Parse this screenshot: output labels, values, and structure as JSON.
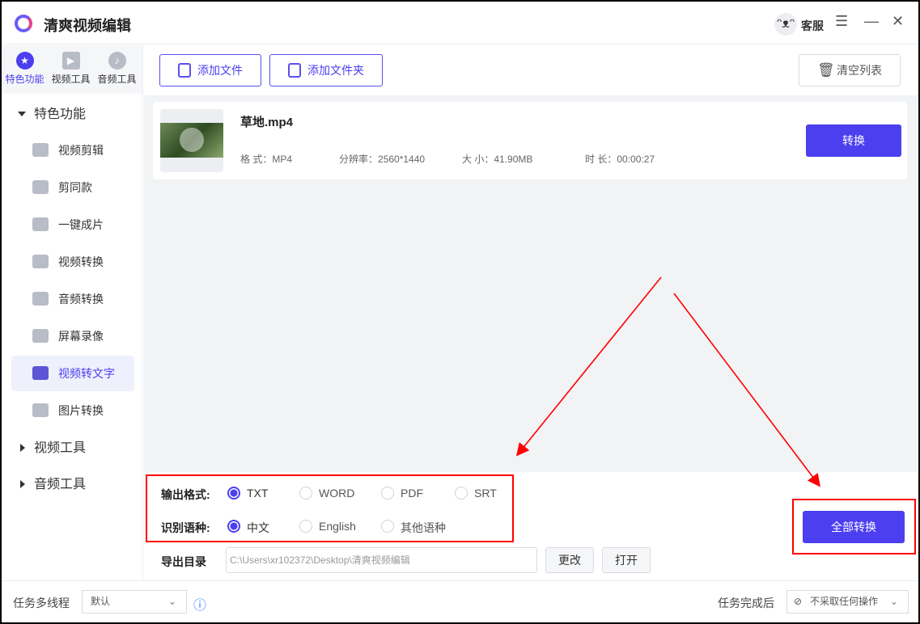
{
  "app": {
    "title": "清爽视频编辑",
    "support": "客服"
  },
  "sidebar": {
    "tabs": [
      {
        "label": "特色功能",
        "active": true
      },
      {
        "label": "视频工具"
      },
      {
        "label": "音频工具"
      }
    ],
    "groups": [
      {
        "label": "特色功能",
        "expanded": true,
        "items": [
          "视频剪辑",
          "剪同款",
          "一键成片",
          "视频转换",
          "音频转换",
          "屏幕录像",
          "视频转文字",
          "图片转换"
        ],
        "active": "视频转文字"
      },
      {
        "label": "视频工具"
      },
      {
        "label": "音频工具"
      }
    ]
  },
  "toolbar": {
    "add_file": "添加文件",
    "add_folder": "添加文件夹",
    "clear": "清空列表"
  },
  "file": {
    "name": "草地.mp4",
    "format_label": "格  式：",
    "format": "MP4",
    "res_label": "分辨率：",
    "res": "2560*1440",
    "size_label": "大  小：",
    "size": "41.90MB",
    "dur_label": "时  长：",
    "dur": "00:00:27",
    "convert": "转换"
  },
  "settings": {
    "format_label": "输出格式:",
    "formats": [
      "TXT",
      "WORD",
      "PDF",
      "SRT"
    ],
    "format_selected": "TXT",
    "lang_label": "识别语种:",
    "langs": [
      "中文",
      "English",
      "其他语种"
    ],
    "lang_selected": "中文",
    "dir_label": "导出目录",
    "dir": "C:\\Users\\xr102372\\Desktop\\清爽视频编辑",
    "change": "更改",
    "open": "打开",
    "convert_all": "全部转换"
  },
  "footer": {
    "threads_label": "任务多线程",
    "threads": "默认",
    "after_label": "任务完成后",
    "after": "不采取任何操作"
  },
  "colors": {
    "accent": "#4b3ff0",
    "annotation": "#ff0000"
  }
}
